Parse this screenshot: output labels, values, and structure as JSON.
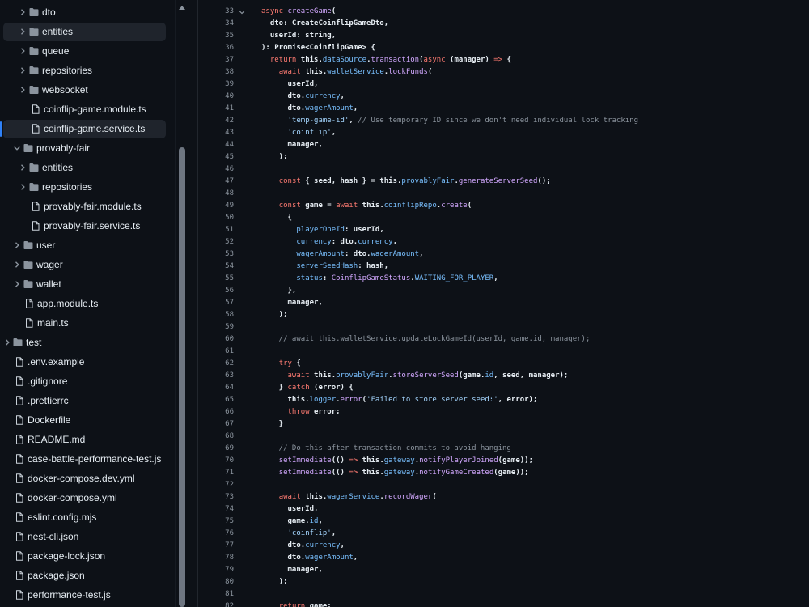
{
  "file_tree": [
    {
      "label": "dto",
      "kind": "folder",
      "expanded": false,
      "depth": 2,
      "selected": false
    },
    {
      "label": "entities",
      "kind": "folder",
      "expanded": false,
      "depth": 2,
      "selected": true
    },
    {
      "label": "queue",
      "kind": "folder",
      "expanded": false,
      "depth": 2,
      "selected": false
    },
    {
      "label": "repositories",
      "kind": "folder",
      "expanded": false,
      "depth": 2,
      "selected": false
    },
    {
      "label": "websocket",
      "kind": "folder",
      "expanded": false,
      "depth": 2,
      "selected": false
    },
    {
      "label": "coinflip-game.module.ts",
      "kind": "file",
      "depth": 2,
      "selected": false
    },
    {
      "label": "coinflip-game.service.ts",
      "kind": "file",
      "depth": 2,
      "selected": true,
      "active": true
    },
    {
      "label": "provably-fair",
      "kind": "folder",
      "expanded": true,
      "depth": 1,
      "selected": false
    },
    {
      "label": "entities",
      "kind": "folder",
      "expanded": false,
      "depth": 2,
      "selected": false
    },
    {
      "label": "repositories",
      "kind": "folder",
      "expanded": false,
      "depth": 2,
      "selected": false
    },
    {
      "label": "provably-fair.module.ts",
      "kind": "file",
      "depth": 2,
      "selected": false
    },
    {
      "label": "provably-fair.service.ts",
      "kind": "file",
      "depth": 2,
      "selected": false
    },
    {
      "label": "user",
      "kind": "folder",
      "expanded": false,
      "depth": 1,
      "selected": false
    },
    {
      "label": "wager",
      "kind": "folder",
      "expanded": false,
      "depth": 1,
      "selected": false
    },
    {
      "label": "wallet",
      "kind": "folder",
      "expanded": false,
      "depth": 1,
      "selected": false
    },
    {
      "label": "app.module.ts",
      "kind": "file",
      "depth": 1,
      "selected": false
    },
    {
      "label": "main.ts",
      "kind": "file",
      "depth": 1,
      "selected": false
    },
    {
      "label": "test",
      "kind": "folder",
      "expanded": false,
      "depth": 0,
      "selected": false
    },
    {
      "label": ".env.example",
      "kind": "file",
      "depth": 0,
      "selected": false
    },
    {
      "label": ".gitignore",
      "kind": "file",
      "depth": 0,
      "selected": false
    },
    {
      "label": ".prettierrc",
      "kind": "file",
      "depth": 0,
      "selected": false
    },
    {
      "label": "Dockerfile",
      "kind": "file",
      "depth": 0,
      "selected": false
    },
    {
      "label": "README.md",
      "kind": "file",
      "depth": 0,
      "selected": false
    },
    {
      "label": "case-battle-performance-test.js",
      "kind": "file",
      "depth": 0,
      "selected": false
    },
    {
      "label": "docker-compose.dev.yml",
      "kind": "file",
      "depth": 0,
      "selected": false
    },
    {
      "label": "docker-compose.yml",
      "kind": "file",
      "depth": 0,
      "selected": false
    },
    {
      "label": "eslint.config.mjs",
      "kind": "file",
      "depth": 0,
      "selected": false
    },
    {
      "label": "nest-cli.json",
      "kind": "file",
      "depth": 0,
      "selected": false
    },
    {
      "label": "package-lock.json",
      "kind": "file",
      "depth": 0,
      "selected": false
    },
    {
      "label": "package.json",
      "kind": "file",
      "depth": 0,
      "selected": false
    },
    {
      "label": "performance-test.js",
      "kind": "file",
      "depth": 0,
      "selected": false
    }
  ],
  "code": {
    "first_line_number": 33,
    "foldable_line": 33,
    "lines": [
      [
        [
          "kw",
          "async "
        ],
        [
          "fn",
          "createGame"
        ],
        [
          "p",
          "("
        ]
      ],
      [
        [
          "p",
          "  dto: CreateCoinflipGameDto,"
        ]
      ],
      [
        [
          "p",
          "  userId: string,"
        ]
      ],
      [
        [
          "p",
          "): Promise<CoinflipGame> {"
        ]
      ],
      [
        [
          "p",
          "  "
        ],
        [
          "kw",
          "return "
        ],
        [
          "p",
          "this."
        ],
        [
          "prop",
          "dataSource"
        ],
        [
          "p",
          "."
        ],
        [
          "fn",
          "transaction"
        ],
        [
          "p",
          "("
        ],
        [
          "kw",
          "async "
        ],
        [
          "p",
          "(manager) "
        ],
        [
          "kw",
          "=> "
        ],
        [
          "p",
          "{"
        ]
      ],
      [
        [
          "p",
          "    "
        ],
        [
          "kw",
          "await "
        ],
        [
          "p",
          "this."
        ],
        [
          "prop",
          "walletService"
        ],
        [
          "p",
          "."
        ],
        [
          "fn",
          "lockFunds"
        ],
        [
          "p",
          "("
        ]
      ],
      [
        [
          "p",
          "      userId,"
        ]
      ],
      [
        [
          "p",
          "      dto."
        ],
        [
          "prop",
          "currency"
        ],
        [
          "p",
          ","
        ]
      ],
      [
        [
          "p",
          "      dto."
        ],
        [
          "prop",
          "wagerAmount"
        ],
        [
          "p",
          ","
        ]
      ],
      [
        [
          "p",
          "      "
        ],
        [
          "str",
          "'temp-game-id'"
        ],
        [
          "p",
          ", "
        ],
        [
          "com",
          "// Use temporary ID since we don't need individual lock tracking"
        ]
      ],
      [
        [
          "p",
          "      "
        ],
        [
          "str",
          "'coinflip'"
        ],
        [
          "p",
          ","
        ]
      ],
      [
        [
          "p",
          "      manager,"
        ]
      ],
      [
        [
          "p",
          "    );"
        ]
      ],
      [
        [
          "p",
          ""
        ]
      ],
      [
        [
          "p",
          "    "
        ],
        [
          "kw",
          "const "
        ],
        [
          "p",
          "{ seed, hash } = this."
        ],
        [
          "prop",
          "provablyFair"
        ],
        [
          "p",
          "."
        ],
        [
          "fn",
          "generateServerSeed"
        ],
        [
          "p",
          "();"
        ]
      ],
      [
        [
          "p",
          ""
        ]
      ],
      [
        [
          "p",
          "    "
        ],
        [
          "kw",
          "const "
        ],
        [
          "p",
          "game = "
        ],
        [
          "kw",
          "await "
        ],
        [
          "p",
          "this."
        ],
        [
          "prop",
          "coinflipRepo"
        ],
        [
          "p",
          "."
        ],
        [
          "fn",
          "create"
        ],
        [
          "p",
          "("
        ]
      ],
      [
        [
          "p",
          "      {"
        ]
      ],
      [
        [
          "p",
          "        "
        ],
        [
          "prop",
          "playerOneId"
        ],
        [
          "p",
          ": userId,"
        ]
      ],
      [
        [
          "p",
          "        "
        ],
        [
          "prop",
          "currency"
        ],
        [
          "p",
          ": dto."
        ],
        [
          "prop",
          "currency"
        ],
        [
          "p",
          ","
        ]
      ],
      [
        [
          "p",
          "        "
        ],
        [
          "prop",
          "wagerAmount"
        ],
        [
          "p",
          ": dto."
        ],
        [
          "prop",
          "wagerAmount"
        ],
        [
          "p",
          ","
        ]
      ],
      [
        [
          "p",
          "        "
        ],
        [
          "prop",
          "serverSeedHash"
        ],
        [
          "p",
          ": hash,"
        ]
      ],
      [
        [
          "p",
          "        "
        ],
        [
          "prop",
          "status"
        ],
        [
          "p",
          ": "
        ],
        [
          "fn",
          "CoinflipGameStatus"
        ],
        [
          "p",
          "."
        ],
        [
          "prop",
          "WAITING_FOR_PLAYER"
        ],
        [
          "p",
          ","
        ]
      ],
      [
        [
          "p",
          "      },"
        ]
      ],
      [
        [
          "p",
          "      manager,"
        ]
      ],
      [
        [
          "p",
          "    );"
        ]
      ],
      [
        [
          "p",
          ""
        ]
      ],
      [
        [
          "com",
          "    // await this.walletService.updateLockGameId(userId, game.id, manager);"
        ]
      ],
      [
        [
          "p",
          ""
        ]
      ],
      [
        [
          "p",
          "    "
        ],
        [
          "kw",
          "try "
        ],
        [
          "p",
          "{"
        ]
      ],
      [
        [
          "p",
          "      "
        ],
        [
          "kw",
          "await "
        ],
        [
          "p",
          "this."
        ],
        [
          "prop",
          "provablyFair"
        ],
        [
          "p",
          "."
        ],
        [
          "fn",
          "storeServerSeed"
        ],
        [
          "p",
          "(game."
        ],
        [
          "prop",
          "id"
        ],
        [
          "p",
          ", seed, manager);"
        ]
      ],
      [
        [
          "p",
          "    } "
        ],
        [
          "kw",
          "catch "
        ],
        [
          "p",
          "(error) {"
        ]
      ],
      [
        [
          "p",
          "      this."
        ],
        [
          "prop",
          "logger"
        ],
        [
          "p",
          "."
        ],
        [
          "fn",
          "error"
        ],
        [
          "p",
          "("
        ],
        [
          "str",
          "'Failed to store server seed:'"
        ],
        [
          "p",
          ", error);"
        ]
      ],
      [
        [
          "p",
          "      "
        ],
        [
          "kw",
          "throw "
        ],
        [
          "p",
          "error;"
        ]
      ],
      [
        [
          "p",
          "    }"
        ]
      ],
      [
        [
          "p",
          ""
        ]
      ],
      [
        [
          "com",
          "    // Do this after transaction commits to avoid hanging"
        ]
      ],
      [
        [
          "p",
          "    "
        ],
        [
          "fn",
          "setImmediate"
        ],
        [
          "p",
          "(() "
        ],
        [
          "kw",
          "=> "
        ],
        [
          "p",
          "this."
        ],
        [
          "prop",
          "gateway"
        ],
        [
          "p",
          "."
        ],
        [
          "fn",
          "notifyPlayerJoined"
        ],
        [
          "p",
          "(game));"
        ]
      ],
      [
        [
          "p",
          "    "
        ],
        [
          "fn",
          "setImmediate"
        ],
        [
          "p",
          "(() "
        ],
        [
          "kw",
          "=> "
        ],
        [
          "p",
          "this."
        ],
        [
          "prop",
          "gateway"
        ],
        [
          "p",
          "."
        ],
        [
          "fn",
          "notifyGameCreated"
        ],
        [
          "p",
          "(game));"
        ]
      ],
      [
        [
          "p",
          ""
        ]
      ],
      [
        [
          "p",
          "    "
        ],
        [
          "kw",
          "await "
        ],
        [
          "p",
          "this."
        ],
        [
          "prop",
          "wagerService"
        ],
        [
          "p",
          "."
        ],
        [
          "fn",
          "recordWager"
        ],
        [
          "p",
          "("
        ]
      ],
      [
        [
          "p",
          "      userId,"
        ]
      ],
      [
        [
          "p",
          "      game."
        ],
        [
          "prop",
          "id"
        ],
        [
          "p",
          ","
        ]
      ],
      [
        [
          "p",
          "      "
        ],
        [
          "str",
          "'coinflip'"
        ],
        [
          "p",
          ","
        ]
      ],
      [
        [
          "p",
          "      dto."
        ],
        [
          "prop",
          "currency"
        ],
        [
          "p",
          ","
        ]
      ],
      [
        [
          "p",
          "      dto."
        ],
        [
          "prop",
          "wagerAmount"
        ],
        [
          "p",
          ","
        ]
      ],
      [
        [
          "p",
          "      manager,"
        ]
      ],
      [
        [
          "p",
          "    );"
        ]
      ],
      [
        [
          "p",
          ""
        ]
      ],
      [
        [
          "p",
          "    "
        ],
        [
          "kw",
          "return "
        ],
        [
          "p",
          "game;"
        ]
      ]
    ]
  },
  "colors": {
    "background": "#0d1117",
    "selection": "#1f242c",
    "active_marker": "#2f81f7",
    "keyword": "#ff7b72",
    "function": "#d2a8ff",
    "property": "#79c0ff",
    "string": "#a5d6ff",
    "comment": "#8b949e"
  },
  "icons": {
    "folder": "folder-icon",
    "file": "file-icon",
    "collapsed": "chevron-right-icon",
    "expanded": "chevron-down-icon"
  }
}
